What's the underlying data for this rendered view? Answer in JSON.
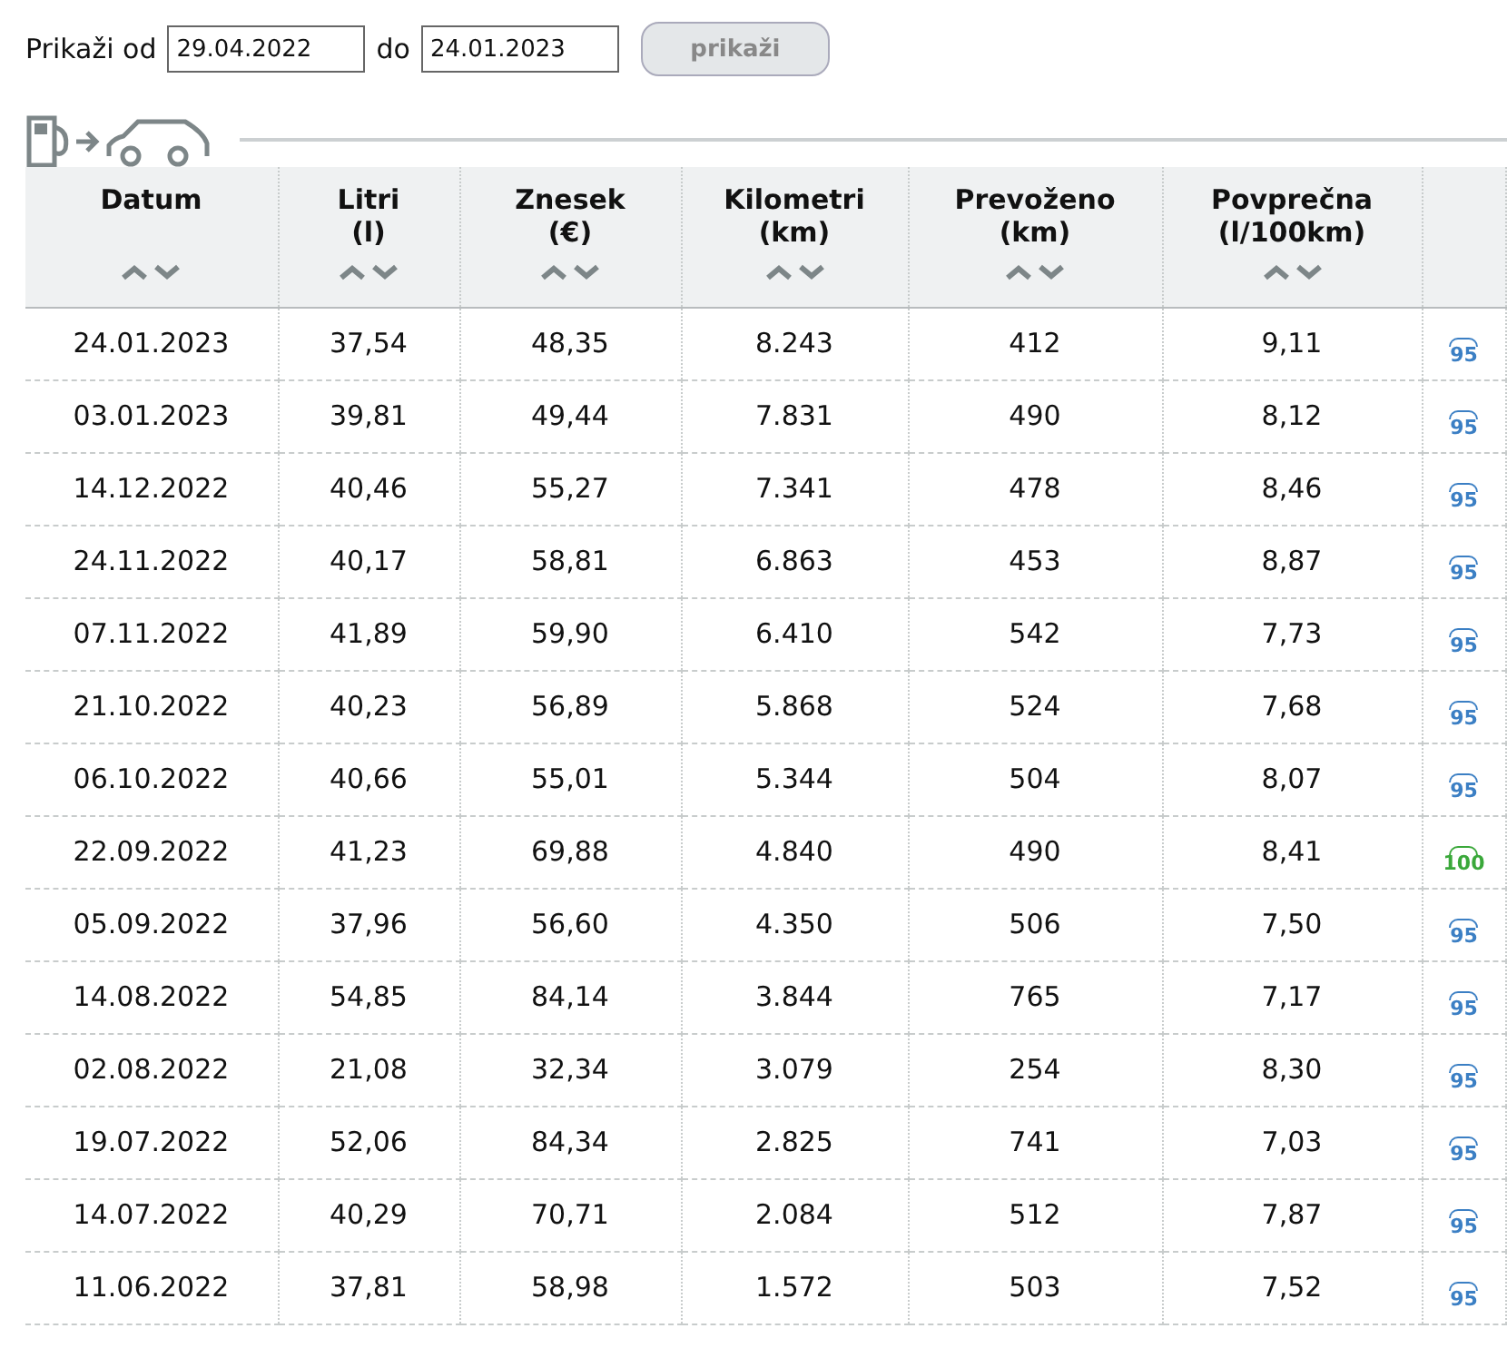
{
  "filter": {
    "from_label": "Prikaži od",
    "from_value": "29.04.2022",
    "to_label": "do",
    "to_value": "24.01.2023",
    "button": "prikaži"
  },
  "table": {
    "columns": [
      {
        "title": "Datum"
      },
      {
        "title": "Litri",
        "unit": "(l)"
      },
      {
        "title": "Znesek",
        "unit": "(€)"
      },
      {
        "title": "Kilometri",
        "unit": "(km)"
      },
      {
        "title": "Prevoženo",
        "unit": "(km)"
      },
      {
        "title": "Povprečna",
        "unit": "(l/100km)"
      }
    ],
    "rows": [
      {
        "cells": [
          "24.01.2023",
          "37,54",
          "48,35",
          "8.243",
          "412",
          "9,11"
        ],
        "fuel": "95",
        "color": "#3b7fc4"
      },
      {
        "cells": [
          "03.01.2023",
          "39,81",
          "49,44",
          "7.831",
          "490",
          "8,12"
        ],
        "fuel": "95",
        "color": "#3b7fc4"
      },
      {
        "cells": [
          "14.12.2022",
          "40,46",
          "55,27",
          "7.341",
          "478",
          "8,46"
        ],
        "fuel": "95",
        "color": "#3b7fc4"
      },
      {
        "cells": [
          "24.11.2022",
          "40,17",
          "58,81",
          "6.863",
          "453",
          "8,87"
        ],
        "fuel": "95",
        "color": "#3b7fc4"
      },
      {
        "cells": [
          "07.11.2022",
          "41,89",
          "59,90",
          "6.410",
          "542",
          "7,73"
        ],
        "fuel": "95",
        "color": "#3b7fc4"
      },
      {
        "cells": [
          "21.10.2022",
          "40,23",
          "56,89",
          "5.868",
          "524",
          "7,68"
        ],
        "fuel": "95",
        "color": "#3b7fc4"
      },
      {
        "cells": [
          "06.10.2022",
          "40,66",
          "55,01",
          "5.344",
          "504",
          "8,07"
        ],
        "fuel": "95",
        "color": "#3b7fc4"
      },
      {
        "cells": [
          "22.09.2022",
          "41,23",
          "69,88",
          "4.840",
          "490",
          "8,41"
        ],
        "fuel": "100",
        "color": "#3aa83a"
      },
      {
        "cells": [
          "05.09.2022",
          "37,96",
          "56,60",
          "4.350",
          "506",
          "7,50"
        ],
        "fuel": "95",
        "color": "#3b7fc4"
      },
      {
        "cells": [
          "14.08.2022",
          "54,85",
          "84,14",
          "3.844",
          "765",
          "7,17"
        ],
        "fuel": "95",
        "color": "#3b7fc4"
      },
      {
        "cells": [
          "02.08.2022",
          "21,08",
          "32,34",
          "3.079",
          "254",
          "8,30"
        ],
        "fuel": "95",
        "color": "#3b7fc4"
      },
      {
        "cells": [
          "19.07.2022",
          "52,06",
          "84,34",
          "2.825",
          "741",
          "7,03"
        ],
        "fuel": "95",
        "color": "#3b7fc4"
      },
      {
        "cells": [
          "14.07.2022",
          "40,29",
          "70,71",
          "2.084",
          "512",
          "7,87"
        ],
        "fuel": "95",
        "color": "#3b7fc4"
      },
      {
        "cells": [
          "11.06.2022",
          "37,81",
          "58,98",
          "1.572",
          "503",
          "7,52"
        ],
        "fuel": "95",
        "color": "#3b7fc4"
      }
    ]
  }
}
